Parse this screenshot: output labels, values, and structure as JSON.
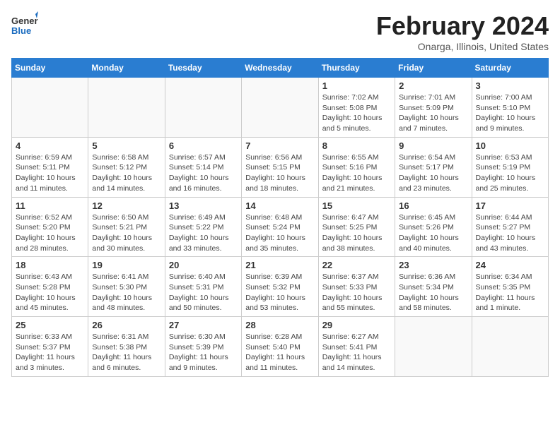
{
  "header": {
    "logo_line1": "General",
    "logo_line2": "Blue",
    "month_title": "February 2024",
    "location": "Onarga, Illinois, United States"
  },
  "weekdays": [
    "Sunday",
    "Monday",
    "Tuesday",
    "Wednesday",
    "Thursday",
    "Friday",
    "Saturday"
  ],
  "weeks": [
    [
      {
        "day": "",
        "info": ""
      },
      {
        "day": "",
        "info": ""
      },
      {
        "day": "",
        "info": ""
      },
      {
        "day": "",
        "info": ""
      },
      {
        "day": "1",
        "info": "Sunrise: 7:02 AM\nSunset: 5:08 PM\nDaylight: 10 hours\nand 5 minutes."
      },
      {
        "day": "2",
        "info": "Sunrise: 7:01 AM\nSunset: 5:09 PM\nDaylight: 10 hours\nand 7 minutes."
      },
      {
        "day": "3",
        "info": "Sunrise: 7:00 AM\nSunset: 5:10 PM\nDaylight: 10 hours\nand 9 minutes."
      }
    ],
    [
      {
        "day": "4",
        "info": "Sunrise: 6:59 AM\nSunset: 5:11 PM\nDaylight: 10 hours\nand 11 minutes."
      },
      {
        "day": "5",
        "info": "Sunrise: 6:58 AM\nSunset: 5:12 PM\nDaylight: 10 hours\nand 14 minutes."
      },
      {
        "day": "6",
        "info": "Sunrise: 6:57 AM\nSunset: 5:14 PM\nDaylight: 10 hours\nand 16 minutes."
      },
      {
        "day": "7",
        "info": "Sunrise: 6:56 AM\nSunset: 5:15 PM\nDaylight: 10 hours\nand 18 minutes."
      },
      {
        "day": "8",
        "info": "Sunrise: 6:55 AM\nSunset: 5:16 PM\nDaylight: 10 hours\nand 21 minutes."
      },
      {
        "day": "9",
        "info": "Sunrise: 6:54 AM\nSunset: 5:17 PM\nDaylight: 10 hours\nand 23 minutes."
      },
      {
        "day": "10",
        "info": "Sunrise: 6:53 AM\nSunset: 5:19 PM\nDaylight: 10 hours\nand 25 minutes."
      }
    ],
    [
      {
        "day": "11",
        "info": "Sunrise: 6:52 AM\nSunset: 5:20 PM\nDaylight: 10 hours\nand 28 minutes."
      },
      {
        "day": "12",
        "info": "Sunrise: 6:50 AM\nSunset: 5:21 PM\nDaylight: 10 hours\nand 30 minutes."
      },
      {
        "day": "13",
        "info": "Sunrise: 6:49 AM\nSunset: 5:22 PM\nDaylight: 10 hours\nand 33 minutes."
      },
      {
        "day": "14",
        "info": "Sunrise: 6:48 AM\nSunset: 5:24 PM\nDaylight: 10 hours\nand 35 minutes."
      },
      {
        "day": "15",
        "info": "Sunrise: 6:47 AM\nSunset: 5:25 PM\nDaylight: 10 hours\nand 38 minutes."
      },
      {
        "day": "16",
        "info": "Sunrise: 6:45 AM\nSunset: 5:26 PM\nDaylight: 10 hours\nand 40 minutes."
      },
      {
        "day": "17",
        "info": "Sunrise: 6:44 AM\nSunset: 5:27 PM\nDaylight: 10 hours\nand 43 minutes."
      }
    ],
    [
      {
        "day": "18",
        "info": "Sunrise: 6:43 AM\nSunset: 5:28 PM\nDaylight: 10 hours\nand 45 minutes."
      },
      {
        "day": "19",
        "info": "Sunrise: 6:41 AM\nSunset: 5:30 PM\nDaylight: 10 hours\nand 48 minutes."
      },
      {
        "day": "20",
        "info": "Sunrise: 6:40 AM\nSunset: 5:31 PM\nDaylight: 10 hours\nand 50 minutes."
      },
      {
        "day": "21",
        "info": "Sunrise: 6:39 AM\nSunset: 5:32 PM\nDaylight: 10 hours\nand 53 minutes."
      },
      {
        "day": "22",
        "info": "Sunrise: 6:37 AM\nSunset: 5:33 PM\nDaylight: 10 hours\nand 55 minutes."
      },
      {
        "day": "23",
        "info": "Sunrise: 6:36 AM\nSunset: 5:34 PM\nDaylight: 10 hours\nand 58 minutes."
      },
      {
        "day": "24",
        "info": "Sunrise: 6:34 AM\nSunset: 5:35 PM\nDaylight: 11 hours\nand 1 minute."
      }
    ],
    [
      {
        "day": "25",
        "info": "Sunrise: 6:33 AM\nSunset: 5:37 PM\nDaylight: 11 hours\nand 3 minutes."
      },
      {
        "day": "26",
        "info": "Sunrise: 6:31 AM\nSunset: 5:38 PM\nDaylight: 11 hours\nand 6 minutes."
      },
      {
        "day": "27",
        "info": "Sunrise: 6:30 AM\nSunset: 5:39 PM\nDaylight: 11 hours\nand 9 minutes."
      },
      {
        "day": "28",
        "info": "Sunrise: 6:28 AM\nSunset: 5:40 PM\nDaylight: 11 hours\nand 11 minutes."
      },
      {
        "day": "29",
        "info": "Sunrise: 6:27 AM\nSunset: 5:41 PM\nDaylight: 11 hours\nand 14 minutes."
      },
      {
        "day": "",
        "info": ""
      },
      {
        "day": "",
        "info": ""
      }
    ]
  ]
}
